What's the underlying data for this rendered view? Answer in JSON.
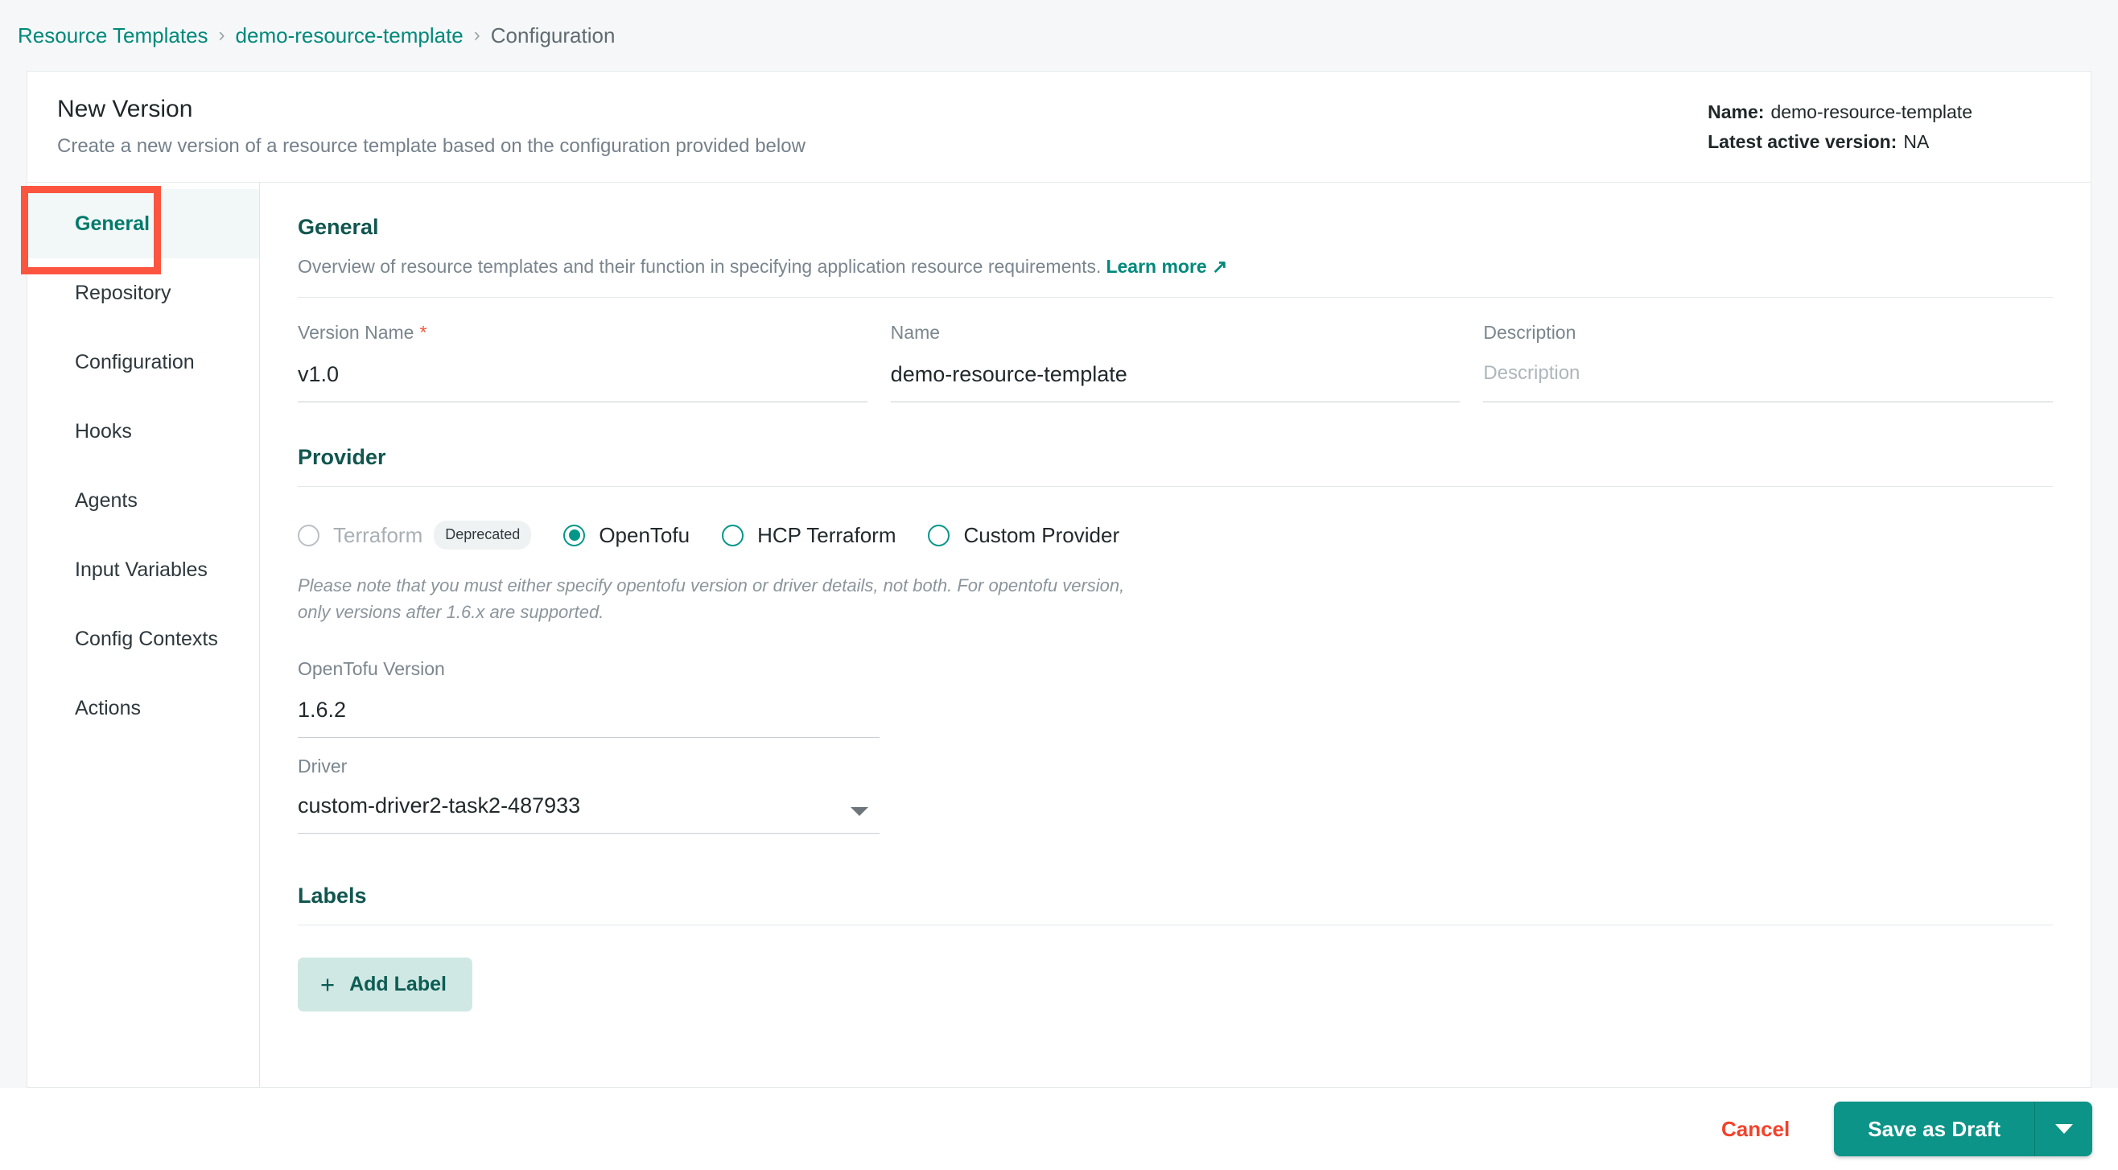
{
  "breadcrumb": {
    "items": [
      {
        "label": "Resource Templates",
        "type": "link"
      },
      {
        "label": "demo-resource-template",
        "type": "link"
      },
      {
        "label": "Configuration",
        "type": "current"
      }
    ],
    "separator": "›"
  },
  "header": {
    "title": "New Version",
    "subtitle": "Create a new version of a resource template based on the configuration provided below",
    "meta": {
      "name_label": "Name:",
      "name_value": "demo-resource-template",
      "version_label": "Latest active version:",
      "version_value": "NA"
    }
  },
  "sidebar": {
    "items": [
      {
        "label": "General",
        "active": true
      },
      {
        "label": "Repository",
        "active": false
      },
      {
        "label": "Configuration",
        "active": false
      },
      {
        "label": "Hooks",
        "active": false
      },
      {
        "label": "Agents",
        "active": false
      },
      {
        "label": "Input Variables",
        "active": false
      },
      {
        "label": "Config Contexts",
        "active": false
      },
      {
        "label": "Actions",
        "active": false
      }
    ]
  },
  "general": {
    "section_title": "General",
    "description": "Overview of resource templates and their function in specifying application resource requirements.",
    "learn_more": "Learn more ↗",
    "fields": {
      "version_name": {
        "label": "Version Name",
        "required_marker": "*",
        "value": "v1.0"
      },
      "name": {
        "label": "Name",
        "value": "demo-resource-template"
      },
      "description": {
        "label": "Description",
        "value": "",
        "placeholder": "Description"
      }
    }
  },
  "provider": {
    "section_title": "Provider",
    "options": [
      {
        "label": "Terraform",
        "selected": false,
        "disabled": true,
        "badge": "Deprecated"
      },
      {
        "label": "OpenTofu",
        "selected": true,
        "disabled": false,
        "badge": ""
      },
      {
        "label": "HCP Terraform",
        "selected": false,
        "disabled": false,
        "badge": ""
      },
      {
        "label": "Custom Provider",
        "selected": false,
        "disabled": false,
        "badge": ""
      }
    ],
    "note": "Please note that you must either specify opentofu version or driver details, not both. For opentofu version, only versions after 1.6.x are supported.",
    "version_field": {
      "label": "OpenTofu Version",
      "value": "1.6.2"
    },
    "driver_field": {
      "label": "Driver",
      "value": "custom-driver2-task2-487933"
    }
  },
  "labels": {
    "section_title": "Labels",
    "add_button": "Add Label",
    "plus_icon": "+"
  },
  "footer": {
    "cancel": "Cancel",
    "save": "Save as Draft"
  },
  "colors": {
    "accent_teal": "#009688",
    "heading_teal": "#10564f",
    "link_teal": "#00897b",
    "danger_red": "#f4422a",
    "required_red": "#f4573f",
    "annotation_red": "#fb5540",
    "save_button": "#0d9488",
    "add_button_bg": "#cfe8e4",
    "page_bg": "#f5f7f8"
  }
}
